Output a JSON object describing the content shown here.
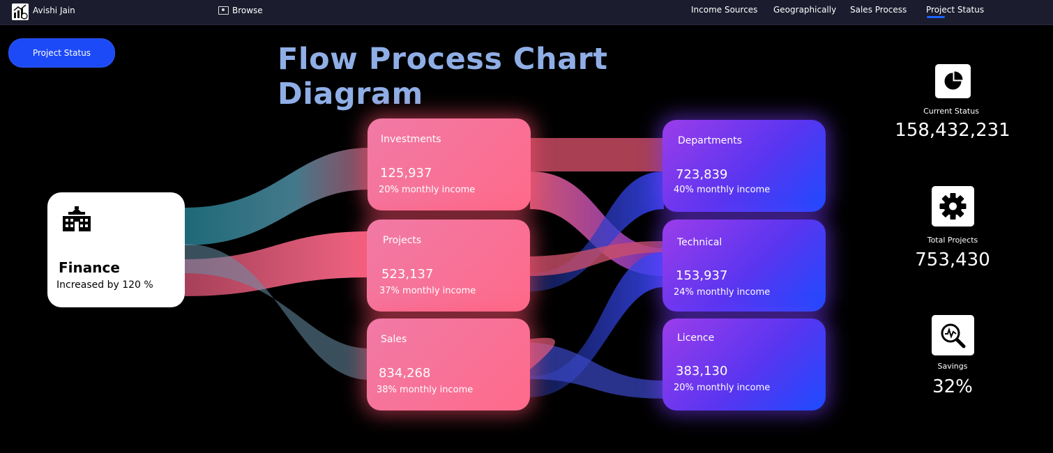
{
  "header": {
    "user_name": "Avishi Jain",
    "browse_label": "Browse",
    "nav": [
      "Income Sources",
      "Geographically",
      "Sales Process",
      "Project Status"
    ],
    "active_nav": "Project Status"
  },
  "toolbar": {
    "project_status_button": "Project Status"
  },
  "page": {
    "title": "Flow Process Chart Diagram"
  },
  "source": {
    "label": "Finance",
    "sub": "Increased by 120 %",
    "icon": "bank-building-icon"
  },
  "middle_nodes": [
    {
      "label": "Investments",
      "value": "125,937",
      "sub": "20% monthly income"
    },
    {
      "label": "Projects",
      "value": "523,137",
      "sub": "37% monthly income"
    },
    {
      "label": "Sales",
      "value": "834,268",
      "sub": "38% monthly income"
    }
  ],
  "right_nodes": [
    {
      "label": "Departments",
      "value": "723,839",
      "sub": "40% monthly income"
    },
    {
      "label": "Technical",
      "value": "153,937",
      "sub": "24% monthly income"
    },
    {
      "label": "Licence",
      "value": "383,130",
      "sub": "20% monthly income"
    }
  ],
  "kpis": [
    {
      "label": "Current Status",
      "value": "158,432,231",
      "icon": "pie-chart-icon"
    },
    {
      "label": "Total Projects",
      "value": "753,430",
      "icon": "gear-icon"
    },
    {
      "label": "Savings",
      "value": "32%",
      "icon": "magnifier-chart-icon"
    }
  ],
  "colors": {
    "accent": "#1d4af7",
    "title": "#8faee6",
    "pink_node": "#ff6a8a",
    "blue_node": "#5a35f0",
    "teal_flow": "#2e7d8e",
    "pink_flow": "#e25c7a",
    "blue_flow": "#2a3fa8"
  }
}
